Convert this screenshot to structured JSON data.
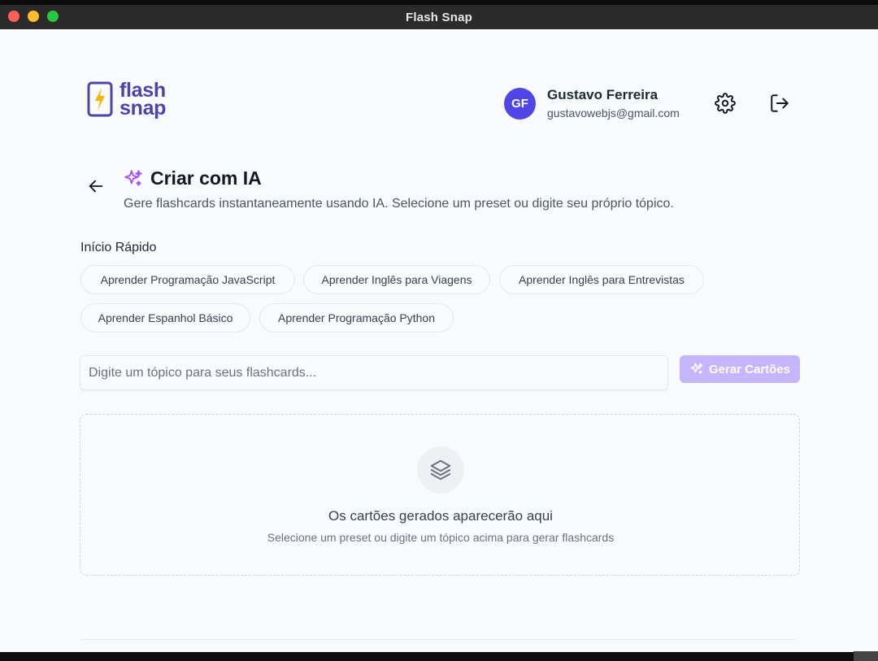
{
  "window": {
    "title": "Flash Snap"
  },
  "brand": {
    "line1": "flash",
    "line2": "snap",
    "color": "#4c44a8",
    "bolt_color": "#f4b400"
  },
  "user": {
    "initials": "GF",
    "name": "Gustavo Ferreira",
    "email": "gustavowebjs@gmail.com",
    "avatar_color": "#4f46e5"
  },
  "icons": {
    "settings": "gear-icon",
    "logout": "logout-icon",
    "back": "arrow-left-icon",
    "sparkle": "sparkles-icon",
    "empty": "layers-icon"
  },
  "page": {
    "title": "Criar com IA",
    "subtitle": "Gere flashcards instantaneamente usando IA. Selecione um preset ou digite seu próprio tópico."
  },
  "quick_start": {
    "label": "Início Rápido",
    "presets": [
      "Aprender Programação JavaScript",
      "Aprender Inglês para Viagens",
      "Aprender Inglês para Entrevistas",
      "Aprender Espanhol Básico",
      "Aprender Programação Python"
    ]
  },
  "input": {
    "placeholder": "Digite um tópico para seus flashcards...",
    "value": ""
  },
  "generate_button": {
    "label": "Gerar Cartões",
    "color": "#c4b5fd"
  },
  "empty_state": {
    "title": "Os cartões gerados aparecerão aqui",
    "subtitle": "Selecione um preset ou digite um tópico acima para gerar flashcards"
  },
  "colors": {
    "accent_purple": "#a855f7",
    "background": "#f8fafc"
  }
}
